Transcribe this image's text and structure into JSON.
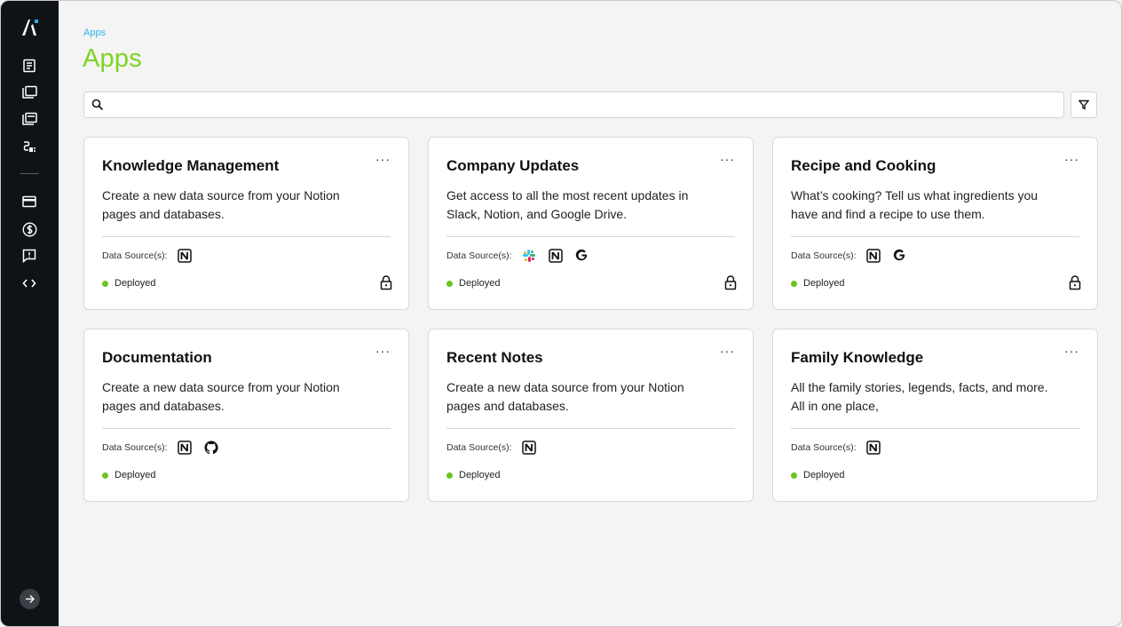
{
  "breadcrumb": "Apps",
  "page_title": "Apps",
  "search": {
    "placeholder": "",
    "value": ""
  },
  "sidebar": {
    "items": [
      {
        "icon": "document-icon"
      },
      {
        "icon": "folders-icon"
      },
      {
        "icon": "folders-alt-icon"
      },
      {
        "icon": "plug-icon"
      },
      {
        "icon": "credit-card-icon"
      },
      {
        "icon": "dollar-icon"
      },
      {
        "icon": "feedback-icon"
      },
      {
        "icon": "code-icon"
      }
    ]
  },
  "data_source_label": "Data Source(s):",
  "colors": {
    "accent": "#7ed321",
    "breadcrumb": "#2bb3e6",
    "status": "#6cc51b",
    "sidebar": "#0f1216"
  },
  "cards": [
    {
      "title": "Knowledge Management",
      "description": "Create a new data source from your Notion pages and databases.",
      "sources": [
        "notion-icon"
      ],
      "status": "Deployed",
      "locked": true
    },
    {
      "title": "Company Updates",
      "description": "Get access to all the most recent updates in Slack, Notion, and Google Drive.",
      "sources": [
        "slack-icon",
        "notion-icon",
        "google-icon"
      ],
      "status": "Deployed",
      "locked": true
    },
    {
      "title": "Recipe and Cooking",
      "description": "What’s cooking? Tell us what ingredients you have and find a recipe to use them.",
      "sources": [
        "notion-icon",
        "google-icon"
      ],
      "status": "Deployed",
      "locked": true
    },
    {
      "title": "Documentation",
      "description": "Create a new data source from your Notion pages and databases.",
      "sources": [
        "notion-icon",
        "github-icon"
      ],
      "status": "Deployed",
      "locked": false
    },
    {
      "title": "Recent Notes",
      "description": "Create a new data source from your Notion pages and databases.",
      "sources": [
        "notion-icon"
      ],
      "status": "Deployed",
      "locked": false
    },
    {
      "title": "Family Knowledge",
      "description": "All the family stories, legends, facts, and more. All in one place,",
      "sources": [
        "notion-icon"
      ],
      "status": "Deployed",
      "locked": false
    }
  ]
}
